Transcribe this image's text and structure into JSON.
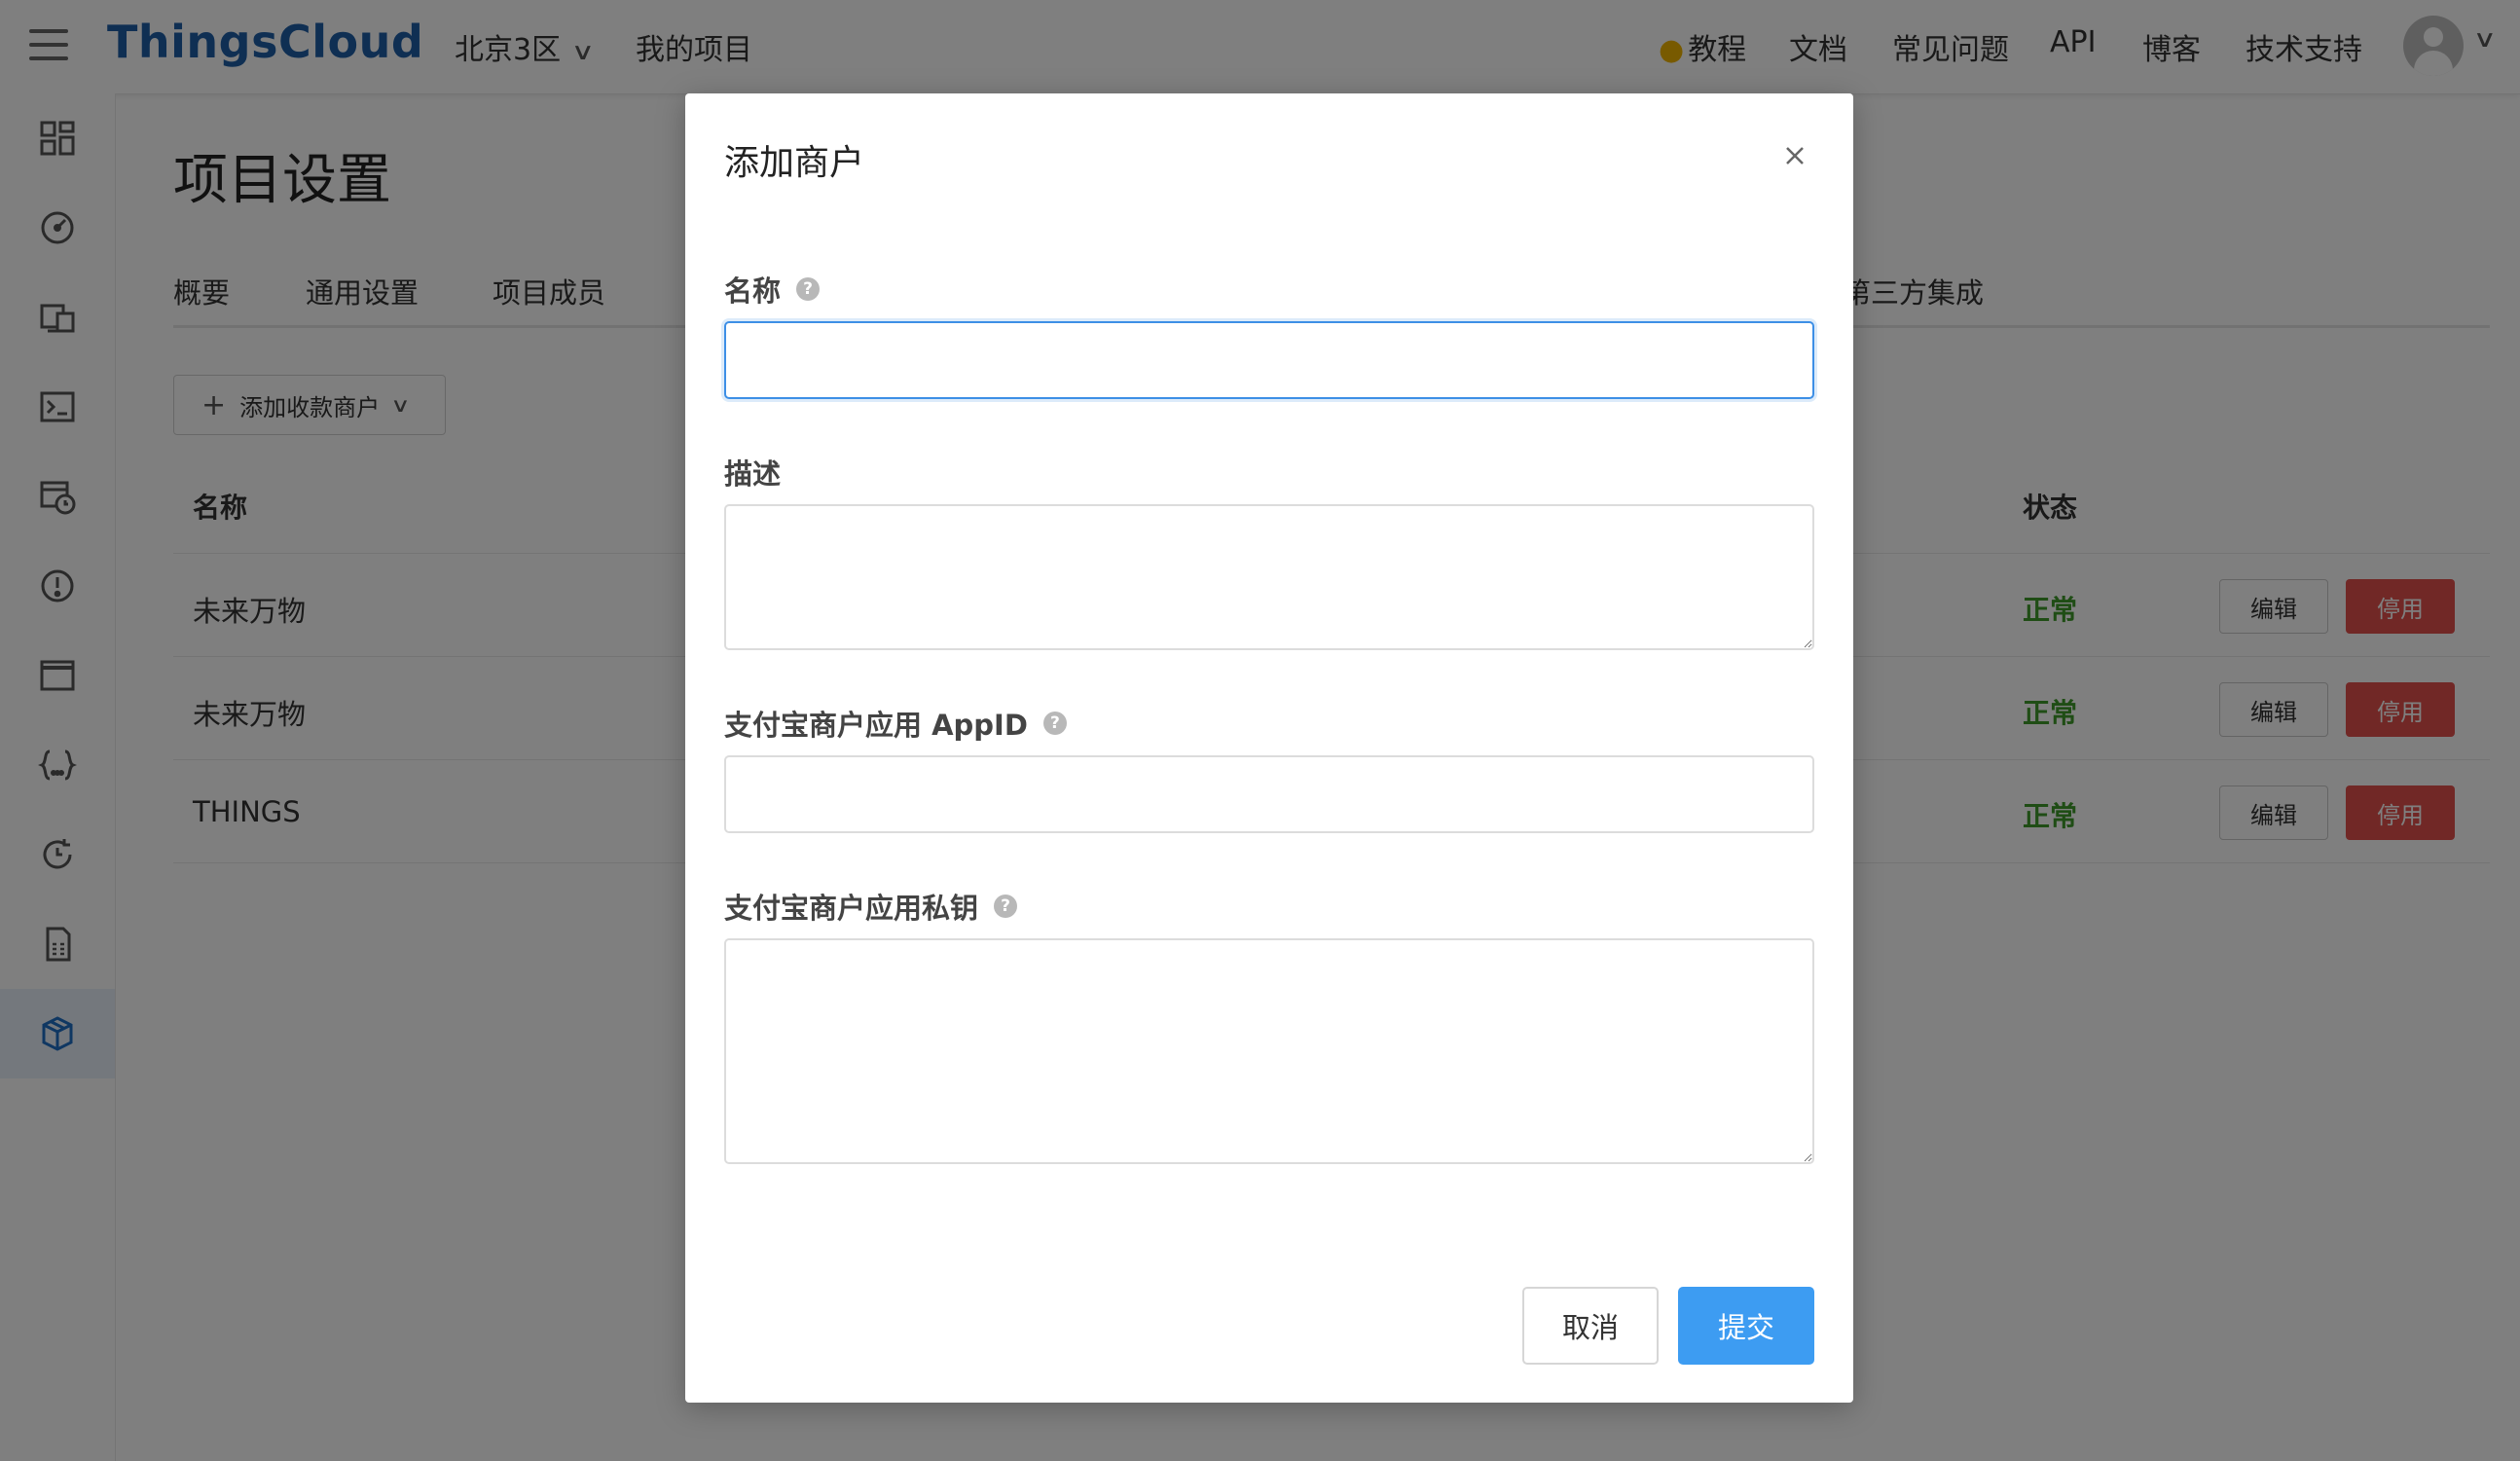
{
  "app": {
    "logo": "ThingsCloud"
  },
  "header": {
    "region": "北京3区",
    "my_projects": "我的项目",
    "links": [
      "教程",
      "文档",
      "常见问题",
      "API",
      "博客",
      "技术支持"
    ]
  },
  "sidebar": {
    "icons": [
      "dashboard-icon",
      "gauge-icon",
      "devices-icon",
      "terminal-icon",
      "schedule-icon",
      "alert-icon",
      "window-icon",
      "code-braces-icon",
      "history-icon",
      "sim-card-icon",
      "package-icon"
    ],
    "active": "package-icon"
  },
  "main": {
    "title": "项目设置",
    "tabs": [
      "概要",
      "通用设置",
      "项目成员",
      "第三方集成"
    ],
    "add_button": "添加收款商户",
    "table": {
      "headers": {
        "name": "名称",
        "status": "状态"
      },
      "rows": [
        {
          "name": "未来万物",
          "status": "正常",
          "edit": "编辑",
          "disable": "停用"
        },
        {
          "name": "未来万物",
          "status": "正常",
          "edit": "编辑",
          "disable": "停用"
        },
        {
          "name": "THINGS",
          "status": "正常",
          "edit": "编辑",
          "disable": "停用"
        }
      ]
    }
  },
  "modal": {
    "title": "添加商户",
    "fields": [
      {
        "label": "名称",
        "help": true,
        "value": "",
        "type": "input"
      },
      {
        "label": "描述",
        "help": false,
        "value": "",
        "type": "textarea"
      },
      {
        "label": "支付宝商户应用 AppID",
        "help": true,
        "value": "",
        "type": "input"
      },
      {
        "label": "支付宝商户应用私钥",
        "help": true,
        "value": "",
        "type": "textarea"
      }
    ],
    "cancel": "取消",
    "submit": "提交"
  },
  "colors": {
    "brand": "#1f5fa6",
    "status_ok": "#3f9a2a",
    "danger": "#e2504c",
    "primary": "#3d9cf2",
    "focus_border": "#3d8fe6"
  }
}
